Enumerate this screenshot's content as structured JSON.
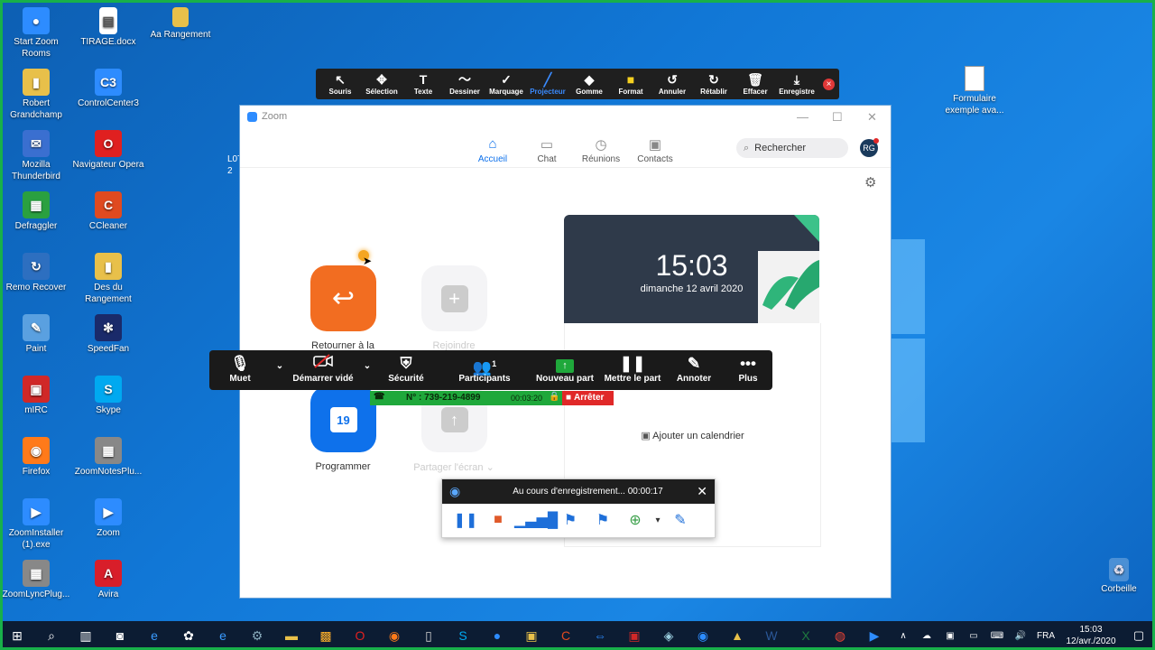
{
  "desktop": {
    "icons_left": [
      {
        "label": "Start Zoom Rooms",
        "icon": "zoom-rooms-icon",
        "color": "#2d8cff",
        "glyph": "●"
      },
      {
        "label": "Robert Grandchamp",
        "icon": "folder-icon",
        "color": "#e8c04a",
        "glyph": "▮"
      },
      {
        "label": "Mozilla Thunderbird",
        "icon": "thunderbird-icon",
        "color": "#3a6fd0",
        "glyph": "✉"
      },
      {
        "label": "Defraggler",
        "icon": "defraggler-icon",
        "color": "#2aa040",
        "glyph": "▦"
      },
      {
        "label": "Remo Recover",
        "icon": "remo-recover-icon",
        "color": "#2d6fc0",
        "glyph": "↻"
      },
      {
        "label": "Paint",
        "icon": "paint-icon",
        "color": "#5aa0e0",
        "glyph": "✎"
      },
      {
        "label": "mIRC",
        "icon": "mirc-icon",
        "color": "#d02828",
        "glyph": "▣"
      },
      {
        "label": "Firefox",
        "icon": "firefox-icon",
        "color": "#ff7a1a",
        "glyph": "◉"
      },
      {
        "label": "ZoomInstaller (1).exe",
        "icon": "zoom-installer-icon",
        "color": "#2d8cff",
        "glyph": "▶"
      },
      {
        "label": "ZoomLyncPlug...",
        "icon": "zoom-lync-plugin-icon",
        "color": "#888888",
        "glyph": "▦"
      }
    ],
    "icons_mid": [
      {
        "label": "TIRAGE.docx",
        "icon": "word-doc-icon",
        "color": "#ffffff",
        "glyph": "▤"
      },
      {
        "label": "ControlCenter3",
        "icon": "control-center-icon",
        "color": "#2d8cff",
        "glyph": "C3"
      },
      {
        "label": "Navigateur Opera",
        "icon": "opera-icon",
        "color": "#e02020",
        "glyph": "O"
      },
      {
        "label": "CCleaner",
        "icon": "ccleaner-icon",
        "color": "#e04a20",
        "glyph": "C"
      },
      {
        "label": "Des du Rangement",
        "icon": "folder-icon",
        "color": "#e8c04a",
        "glyph": "▮"
      },
      {
        "label": "SpeedFan",
        "icon": "speedfan-icon",
        "color": "#1a2a6a",
        "glyph": "✻"
      },
      {
        "label": "Skype",
        "icon": "skype-icon",
        "color": "#00a9f0",
        "glyph": "S"
      },
      {
        "label": "ZoomNotesPlu...",
        "icon": "zoom-notes-plugin-icon",
        "color": "#888888",
        "glyph": "▦"
      },
      {
        "label": "Zoom",
        "icon": "zoom-icon",
        "color": "#2d8cff",
        "glyph": "▶"
      },
      {
        "label": "Avira",
        "icon": "avira-icon",
        "color": "#d81e2a",
        "glyph": "A"
      }
    ],
    "icon_rangement": {
      "label": "Aa Rangement",
      "icon": "folder-icon",
      "color": "#e8c04a"
    },
    "icon_formulaire": {
      "label": "Formulaire exemple ava...",
      "icon": "document-icon"
    },
    "icon_corbeille": {
      "label": "Corbeille",
      "icon": "recycle-bin-icon"
    },
    "partial_label": "L0T\n2"
  },
  "annotate_toolbar": {
    "tools": [
      {
        "label": "Souris",
        "glyph": "↖",
        "name": "tool-souris"
      },
      {
        "label": "Sélection",
        "glyph": "✥",
        "name": "tool-selection"
      },
      {
        "label": "Texte",
        "glyph": "T",
        "name": "tool-texte"
      },
      {
        "label": "Dessiner",
        "glyph": "〜",
        "name": "tool-dessiner"
      },
      {
        "label": "Marquage",
        "glyph": "✓",
        "name": "tool-marquage"
      },
      {
        "label": "Projecteur",
        "glyph": "╱",
        "name": "tool-projecteur",
        "active": true
      },
      {
        "label": "Gomme",
        "glyph": "◆",
        "name": "tool-gomme"
      },
      {
        "label": "Format",
        "glyph": "■",
        "name": "tool-format",
        "color": "#f5d020"
      },
      {
        "label": "Annuler",
        "glyph": "↺",
        "name": "tool-annuler"
      },
      {
        "label": "Rétablir",
        "glyph": "↻",
        "name": "tool-retablir"
      },
      {
        "label": "Effacer",
        "glyph": "🗑",
        "name": "tool-effacer"
      },
      {
        "label": "Enregistre",
        "glyph": "⤓",
        "name": "tool-enregistre"
      }
    ]
  },
  "zoom": {
    "title": "Zoom",
    "tabs": [
      {
        "label": "Accueil",
        "glyph": "⌂",
        "active": true
      },
      {
        "label": "Chat",
        "glyph": "▭"
      },
      {
        "label": "Réunions",
        "glyph": "◷"
      },
      {
        "label": "Contacts",
        "glyph": "▣"
      }
    ],
    "search_placeholder": "Rechercher",
    "avatar": "RG",
    "actions": {
      "return": "Retourner à la",
      "join": "Rejoindre",
      "schedule": "Programmer",
      "schedule_day": "19",
      "share": "Partager l'écran"
    },
    "clock": {
      "time": "15:03",
      "date": "dimanche 12 avril 2020"
    },
    "add_calendar": "Ajouter un calendrier"
  },
  "meeting_bar": {
    "mute": "Muet",
    "video": "Démarrer vidé",
    "security": "Sécurité",
    "participants": "Participants",
    "participants_count": "1",
    "new_share": "Nouveau part",
    "pause_share": "Mettre le part",
    "annotate": "Annoter",
    "more": "Plus"
  },
  "share_status": {
    "meeting_id": "N° : 739-219-4899",
    "elapsed": "00:03:20",
    "stop": "Arrêter"
  },
  "recording": {
    "status": "Au cours d'enregistrement... 00:00:17"
  },
  "taskbar": {
    "language": "FRA",
    "time": "15:03",
    "date": "12/avr./2020"
  }
}
